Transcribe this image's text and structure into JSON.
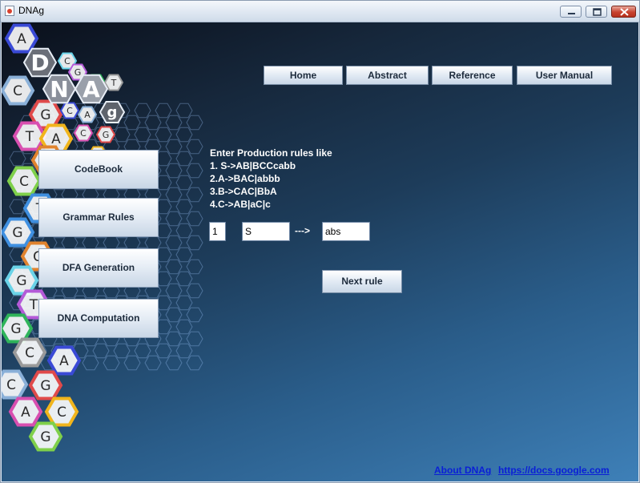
{
  "window": {
    "title": "DNAg"
  },
  "logo": {
    "letters": [
      "D",
      "N",
      "A",
      "g"
    ]
  },
  "hex_letters": [
    "A",
    "C",
    "G",
    "T",
    "A",
    "C",
    "G",
    "C",
    "G",
    "T",
    "G",
    "C",
    "A",
    "C",
    "G",
    "A",
    "C",
    "G",
    "T",
    "A",
    "C",
    "G",
    "C",
    "T",
    "C",
    "A",
    "G",
    "C",
    "T",
    "A"
  ],
  "nav": {
    "home": "Home",
    "abstract": "Abstract",
    "reference": "Reference",
    "user_manual": "User Manual"
  },
  "sidebar": {
    "codebook": "CodeBook",
    "grammar_rules": "Grammar Rules",
    "dfa_generation": "DFA Generation",
    "dna_computation": "DNA Computation"
  },
  "instructions": {
    "heading": "Enter Production rules like",
    "rule1": "1. S->AB|BCCcabb",
    "rule2": "2.A->BAC|abbb",
    "rule3": "3.B->CAC|BbA",
    "rule4": "4.C->AB|aC|c"
  },
  "form": {
    "rule_number": "1",
    "lhs": "S",
    "arrow": "--->",
    "rhs": "abs",
    "next_label": "Next rule"
  },
  "footer": {
    "about": "About DNAg",
    "url": "https://docs.google.com "
  }
}
